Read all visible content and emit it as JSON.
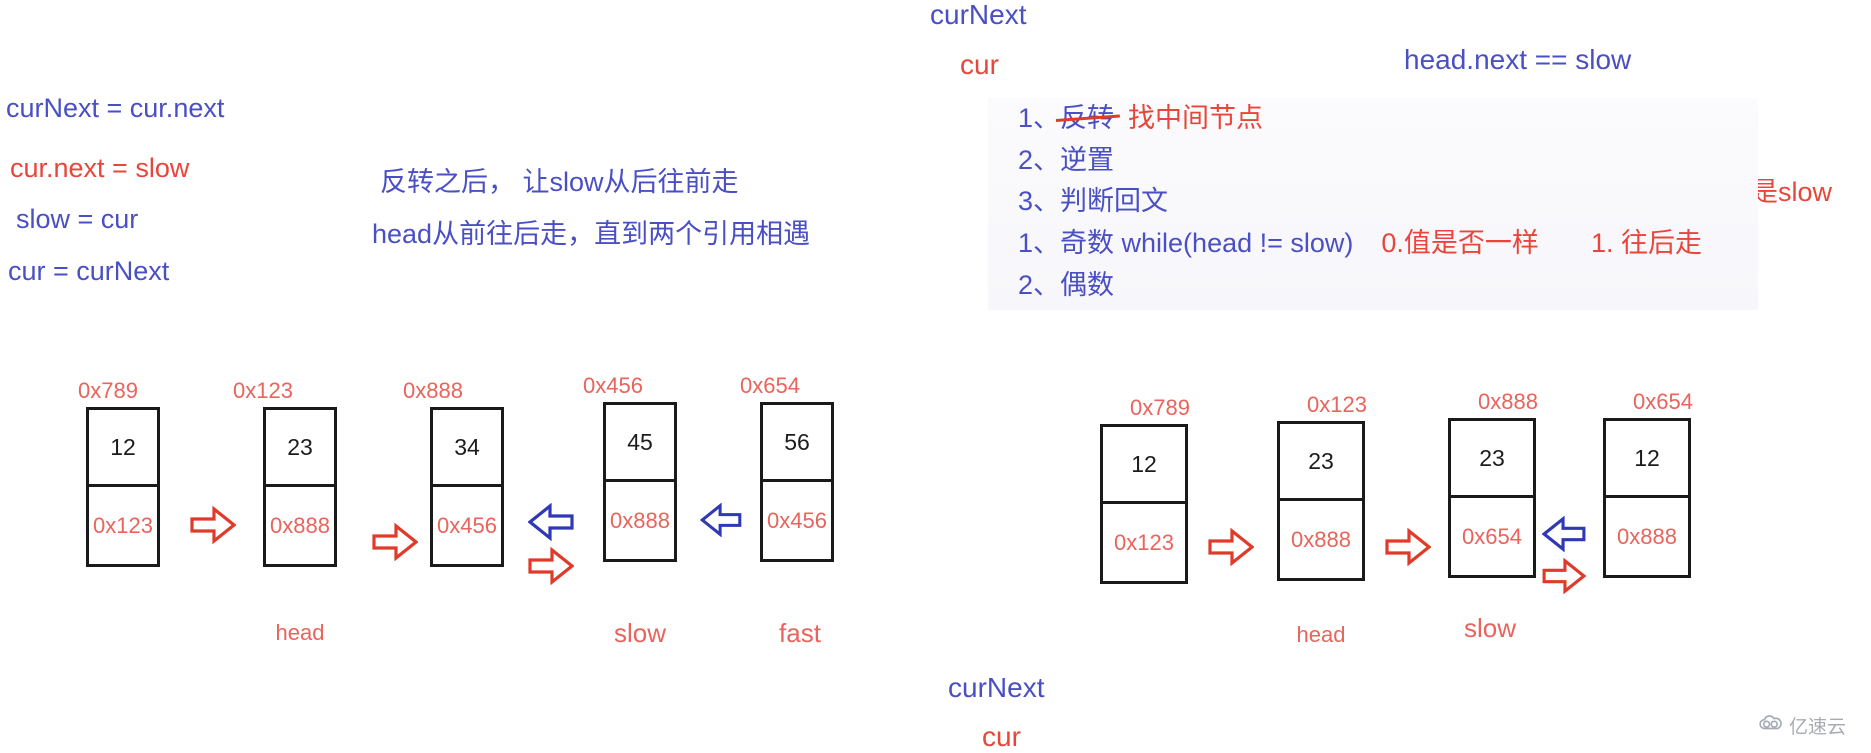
{
  "left_formulas": [
    {
      "text": "curNext = cur.next",
      "color": "blue"
    },
    {
      "text": "cur.next = slow",
      "color": "red"
    },
    {
      "text": "slow = cur",
      "color": "blue"
    },
    {
      "text": "cur = curNext",
      "color": "blue"
    }
  ],
  "middle_note": {
    "line1": "反转之后，  让slow从后往前走",
    "line2": "head从前往后走，直到两个引用相遇"
  },
  "right_panel": {
    "top_labels": {
      "cur_next": "curNext",
      "cur": "cur",
      "head_next_eq_slow": "head.next == slow",
      "even_note": "偶数: 下一个是不是slow"
    },
    "steps": [
      {
        "num": "1、",
        "strike_text": "反转",
        "red_text": "找中间节点"
      },
      {
        "num": "2、",
        "blue_text": "逆置"
      },
      {
        "num": "3、",
        "blue_text": "判断回文"
      },
      {
        "num": "1、",
        "blue_text": "奇数 while(head != slow)",
        "extra_red_1": "0.值是否一样",
        "extra_red_2": "1. 往后走"
      },
      {
        "num": "2、",
        "blue_text": "偶数"
      }
    ],
    "bottom_labels": {
      "cur_next": "curNext",
      "cur": "cur"
    }
  },
  "left_diagram": {
    "nodes": [
      {
        "addr_label": "0x789",
        "value": "12",
        "next_addr": "0x123",
        "name": ""
      },
      {
        "addr_label": "0x123",
        "value": "23",
        "next_addr": "0x888",
        "name": "head"
      },
      {
        "addr_label": "0x888",
        "value": "34",
        "next_addr": "0x456",
        "name": ""
      },
      {
        "addr_label": "0x456",
        "value": "45",
        "next_addr": "0x888",
        "name": "slow"
      },
      {
        "addr_label": "0x654",
        "value": "56",
        "next_addr": "0x456",
        "name": "fast"
      }
    ]
  },
  "right_diagram": {
    "nodes": [
      {
        "addr_label": "0x789",
        "value": "12",
        "next_addr": "0x123",
        "name": ""
      },
      {
        "addr_label": "0x123",
        "value": "23",
        "next_addr": "0x888",
        "name": "head"
      },
      {
        "addr_label": "0x888",
        "value": "23",
        "next_addr": "0x654",
        "name": "slow"
      },
      {
        "addr_label": "0x654",
        "value": "12",
        "next_addr": "0x888",
        "name": ""
      }
    ]
  },
  "watermark": {
    "text": "亿速云"
  },
  "colors": {
    "blue": "#4a4fc4",
    "red": "#e8463a",
    "red_soft": "#e8645c",
    "arrow_blue": "#2f38b5",
    "arrow_red": "#e03a2a",
    "black": "#1c1c1c",
    "background": "#ffffff"
  }
}
